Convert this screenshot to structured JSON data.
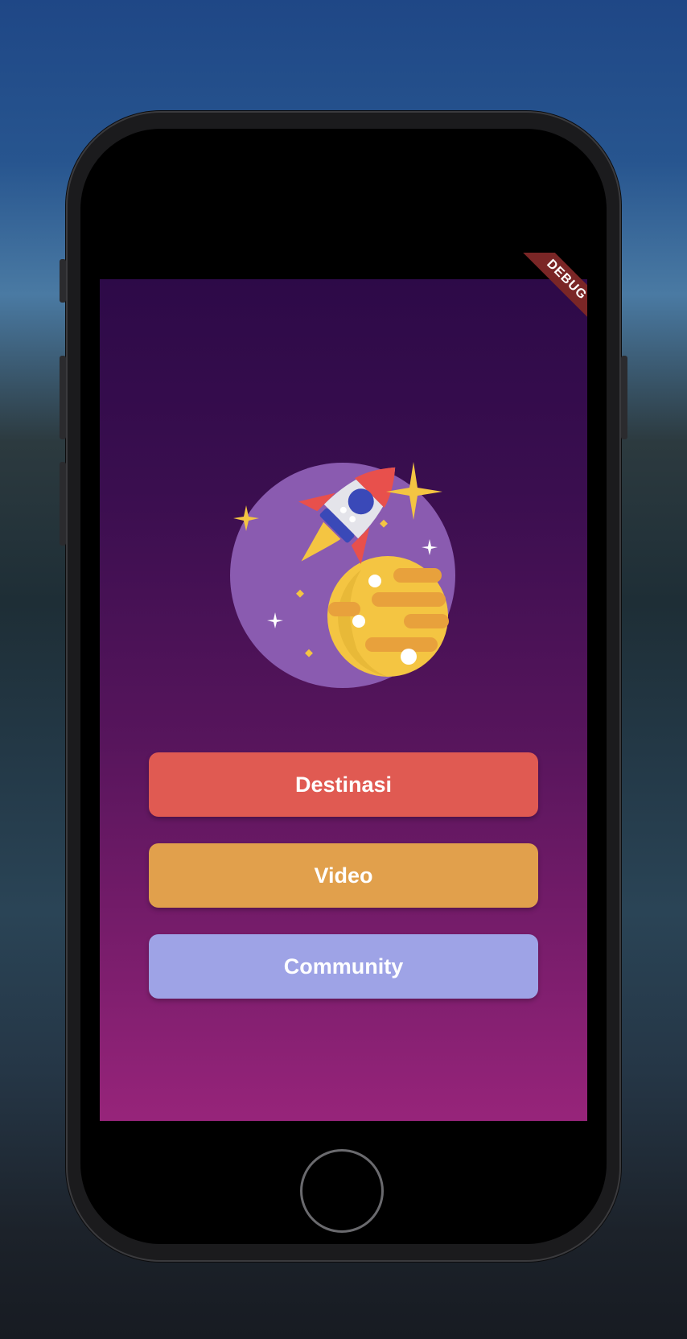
{
  "debug_banner": "DEBUG",
  "buttons": {
    "destinasi": {
      "label": "Destinasi",
      "color": "#e05a52"
    },
    "video": {
      "label": "Video",
      "color": "#e1a04c"
    },
    "community": {
      "label": "Community",
      "color": "#9ea3e6"
    }
  },
  "illustration": {
    "icon": "rocket-planet-icon",
    "colors": {
      "circle": "#8a5bb0",
      "rocket_body": "#e4e4ea",
      "rocket_fin": "#e8504c",
      "window": "#3a49b8",
      "planet": "#f4c542",
      "planet_stripe": "#e8a13c",
      "star": "#f4c542"
    }
  },
  "screen_gradient": {
    "top": "#2d0a48",
    "bottom": "#97247a"
  }
}
